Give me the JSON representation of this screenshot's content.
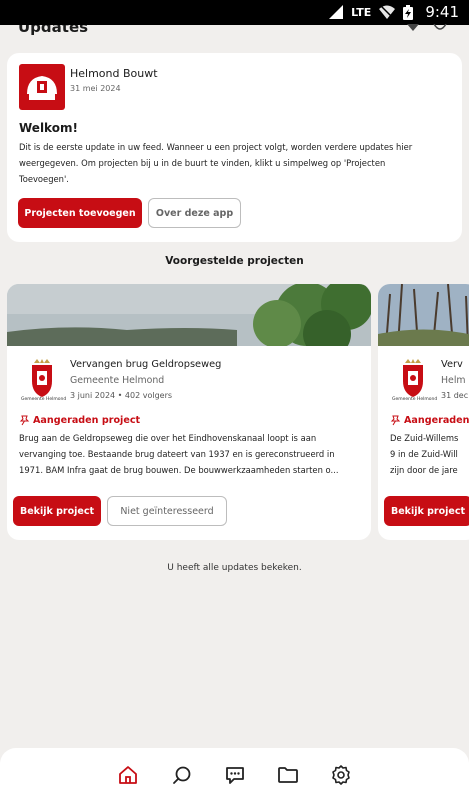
{
  "status_bar": {
    "network": "LTE",
    "time": "9:41"
  },
  "page": {
    "title": "Updates"
  },
  "welcome_card": {
    "organization": "Helmond Bouwt",
    "date": "31 mei 2024",
    "heading": "Welkom!",
    "body_lines": [
      "Dit is de eerste update in uw feed. Wanneer u een project volgt, worden verdere updates hier",
      "weergegeven. Om projecten bij u in de buurt te vinden, klikt u simpelweg op 'Projecten",
      "Toevoegen'."
    ],
    "primary_button": "Projecten toevoegen",
    "secondary_button": "Over deze app"
  },
  "suggested": {
    "title": "Voorgestelde projecten",
    "projects": [
      {
        "logo_caption": "Gemeente Helmond",
        "title": "Vervangen brug Geldropseweg",
        "organization": "Gemeente Helmond",
        "meta": "3 juni 2024 • 402 volgers",
        "recommended": "Aangeraden project",
        "description_lines": [
          "Brug aan de Geldropseweg die over het Eindhovenskanaal loopt is aan",
          "vervanging toe. Bestaande brug dateert van 1937 en is gereconstrueerd in",
          "1971. BAM Infra gaat de brug bouwen. De bouwwerkzaamheden starten o..."
        ],
        "primary_button": "Bekijk project",
        "secondary_button": "Niet geïnteresseerd"
      },
      {
        "logo_caption": "Gemeente Helmond",
        "title": "Verv",
        "organization": "Helm",
        "meta": "31 dec",
        "recommended": "Aangeraden",
        "description_lines": [
          "De Zuid-Willems",
          "9 in de Zuid-Will",
          "zijn door de jare"
        ],
        "primary_button": "Bekijk project"
      }
    ]
  },
  "footer_note": "U heeft alle updates bekeken.",
  "bottom_nav": {
    "items": [
      {
        "icon": "home-icon",
        "active": true
      },
      {
        "icon": "search-icon",
        "active": false
      },
      {
        "icon": "chat-icon",
        "active": false
      },
      {
        "icon": "folder-icon",
        "active": false
      },
      {
        "icon": "settings-icon",
        "active": false
      }
    ]
  },
  "colors": {
    "brand_red": "#c70d14",
    "background": "#f1efed",
    "card": "#ffffff"
  }
}
